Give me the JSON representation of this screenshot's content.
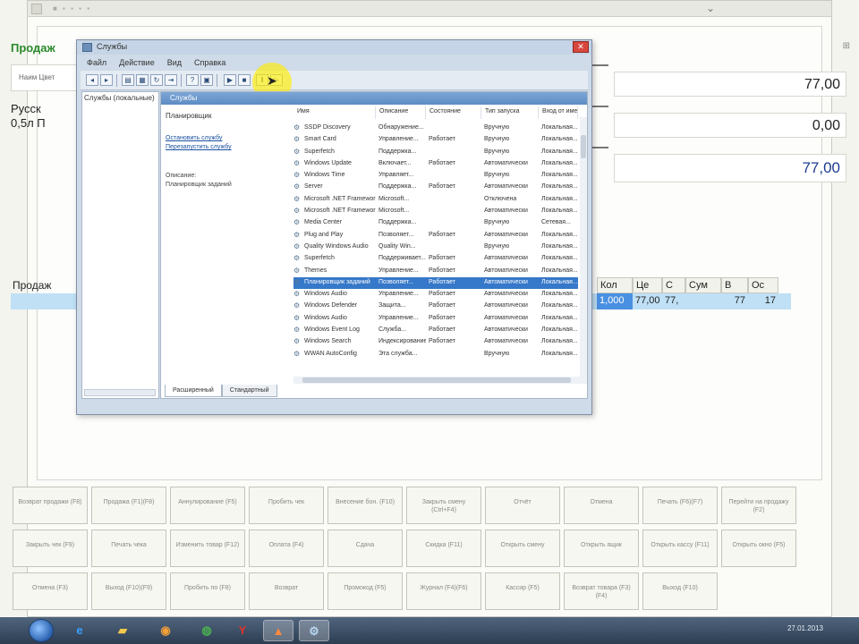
{
  "pos": {
    "section_title": "Продаж",
    "header_label": "Наим Цвет",
    "product_text_line1": "Русск",
    "product_text_line2": "0,5л П",
    "top_right_icon": "pin-icon",
    "totals": [
      "77,00",
      "0,00",
      "77,00"
    ],
    "grid": {
      "left_label": "Продаж",
      "headers": [
        "Кол",
        "Це",
        "С",
        "Сум",
        "В",
        "Ос"
      ],
      "row": [
        "1,000",
        "77,00",
        "77,",
        "",
        "77",
        "17"
      ],
      "row_prefix": "л П"
    },
    "function_buttons": [
      "Возврат продажи (F8)",
      "Продажа (F1)(F8)",
      "Аннулирование (F5)",
      "Пробить чек",
      "Внесение бон. (F10)",
      "Закрыть смену (Ctrl+F4)",
      "Отчёт",
      "Отмена",
      "Печать (F6)(F7)",
      "Перейти на продажу (F2)",
      "Закрыть чек (F9)",
      "Печать чека",
      "Изменить товар (F12)",
      "Оплата (F4)",
      "Сдача",
      "Скидка (F11)",
      "Открыть смену",
      "Открыть ящик",
      "Открыть кассу (F11)",
      "Открыть окно (F5)",
      "Отмена (F3)",
      "Выход (F10)(F9)",
      "Пробить по (F8)",
      "Возврат",
      "Промокод (F5)",
      "Журнал (F4)(F6)",
      "Кассир (F5)",
      "Возврат товара (F3)(F4)",
      "Выход (F10)"
    ]
  },
  "services": {
    "title": "Службы",
    "menu": [
      "Файл",
      "Действие",
      "Вид",
      "Справка"
    ],
    "tree_root": "Службы (локальные)",
    "pane_header": "Службы",
    "desc_title": "Планировщик",
    "desc_links": [
      "Остановить службу",
      "Перезапустить службу"
    ],
    "desc_label": "Описание:",
    "desc_text": "Планировщик заданий",
    "columns": [
      "Имя",
      "Описание",
      "Состояние",
      "Тип запуска",
      "Вход от имени"
    ],
    "rows": [
      [
        "SSDP Discovery",
        "Обнаружение...",
        "",
        "Вручную",
        "Локальная..."
      ],
      [
        "Smart Card",
        "Управление...",
        "Работает",
        "Вручную",
        "Локальная..."
      ],
      [
        "Superfetch",
        "Поддержка...",
        "",
        "Вручную",
        "Локальная..."
      ],
      [
        "Windows Update",
        "Включает...",
        "Работает",
        "Автоматически",
        "Локальная..."
      ],
      [
        "Windows Time",
        "Управляет...",
        "",
        "Вручную",
        "Локальная..."
      ],
      [
        "Server",
        "Поддержка...",
        "Работает",
        "Автоматически",
        "Локальная..."
      ],
      [
        "Microsoft .NET Framework",
        "Microsoft...",
        "",
        "Отключена",
        "Локальная..."
      ],
      [
        "Microsoft .NET Framework",
        "Microsoft...",
        "",
        "Автоматически",
        "Локальная..."
      ],
      [
        "Media Center",
        "Поддержка...",
        "",
        "Вручную",
        "Сетевая..."
      ],
      [
        "Plug and Play",
        "Позволяет...",
        "Работает",
        "Автоматически",
        "Локальная..."
      ],
      [
        "Quality Windows Audio",
        "Quality Win...",
        "",
        "Вручную",
        "Локальная..."
      ],
      [
        "Superfetch",
        "Поддерживает...",
        "Работает",
        "Автоматически",
        "Локальная..."
      ],
      [
        "Themes",
        "Управление...",
        "Работает",
        "Автоматически",
        "Локальная..."
      ],
      [
        "Планировщик заданий",
        "Позволяет...",
        "Работает",
        "Автоматически",
        "Локальная..."
      ],
      [
        "Windows Audio",
        "Управление...",
        "Работает",
        "Автоматически",
        "Локальная..."
      ],
      [
        "Windows Defender",
        "Защита...",
        "Работает",
        "Автоматически",
        "Локальная..."
      ],
      [
        "Windows Audio",
        "Управление...",
        "Работает",
        "Автоматически",
        "Локальная..."
      ],
      [
        "Windows Event Log",
        "Служба...",
        "Работает",
        "Автоматически",
        "Локальная..."
      ],
      [
        "Windows Search",
        "Индексирование...",
        "Работает",
        "Автоматически",
        "Локальная..."
      ],
      [
        "WWAN AutoConfig",
        "Эта служба...",
        "",
        "Вручную",
        "Локальная..."
      ]
    ],
    "selected_row": 13,
    "tabs": [
      "Расширенный",
      "Стандартный"
    ]
  },
  "taskbar": {
    "apps": [
      {
        "name": "ie-icon",
        "glyph": "e",
        "color": "#3aa0ff"
      },
      {
        "name": "folder-icon",
        "glyph": "▰",
        "color": "#f2c94c"
      },
      {
        "name": "media-player-icon",
        "glyph": "◉",
        "color": "#f29f38"
      },
      {
        "name": "chrome-icon",
        "glyph": "◍",
        "color": "#4caf50"
      },
      {
        "name": "yandex-icon",
        "glyph": "Y",
        "color": "#e0312a"
      },
      {
        "name": "pos-app-icon",
        "glyph": "▲",
        "color": "#ff8a3d"
      },
      {
        "name": "services-icon",
        "glyph": "⚙",
        "color": "#b8d4ee"
      }
    ],
    "clock": "27.01.2013"
  }
}
